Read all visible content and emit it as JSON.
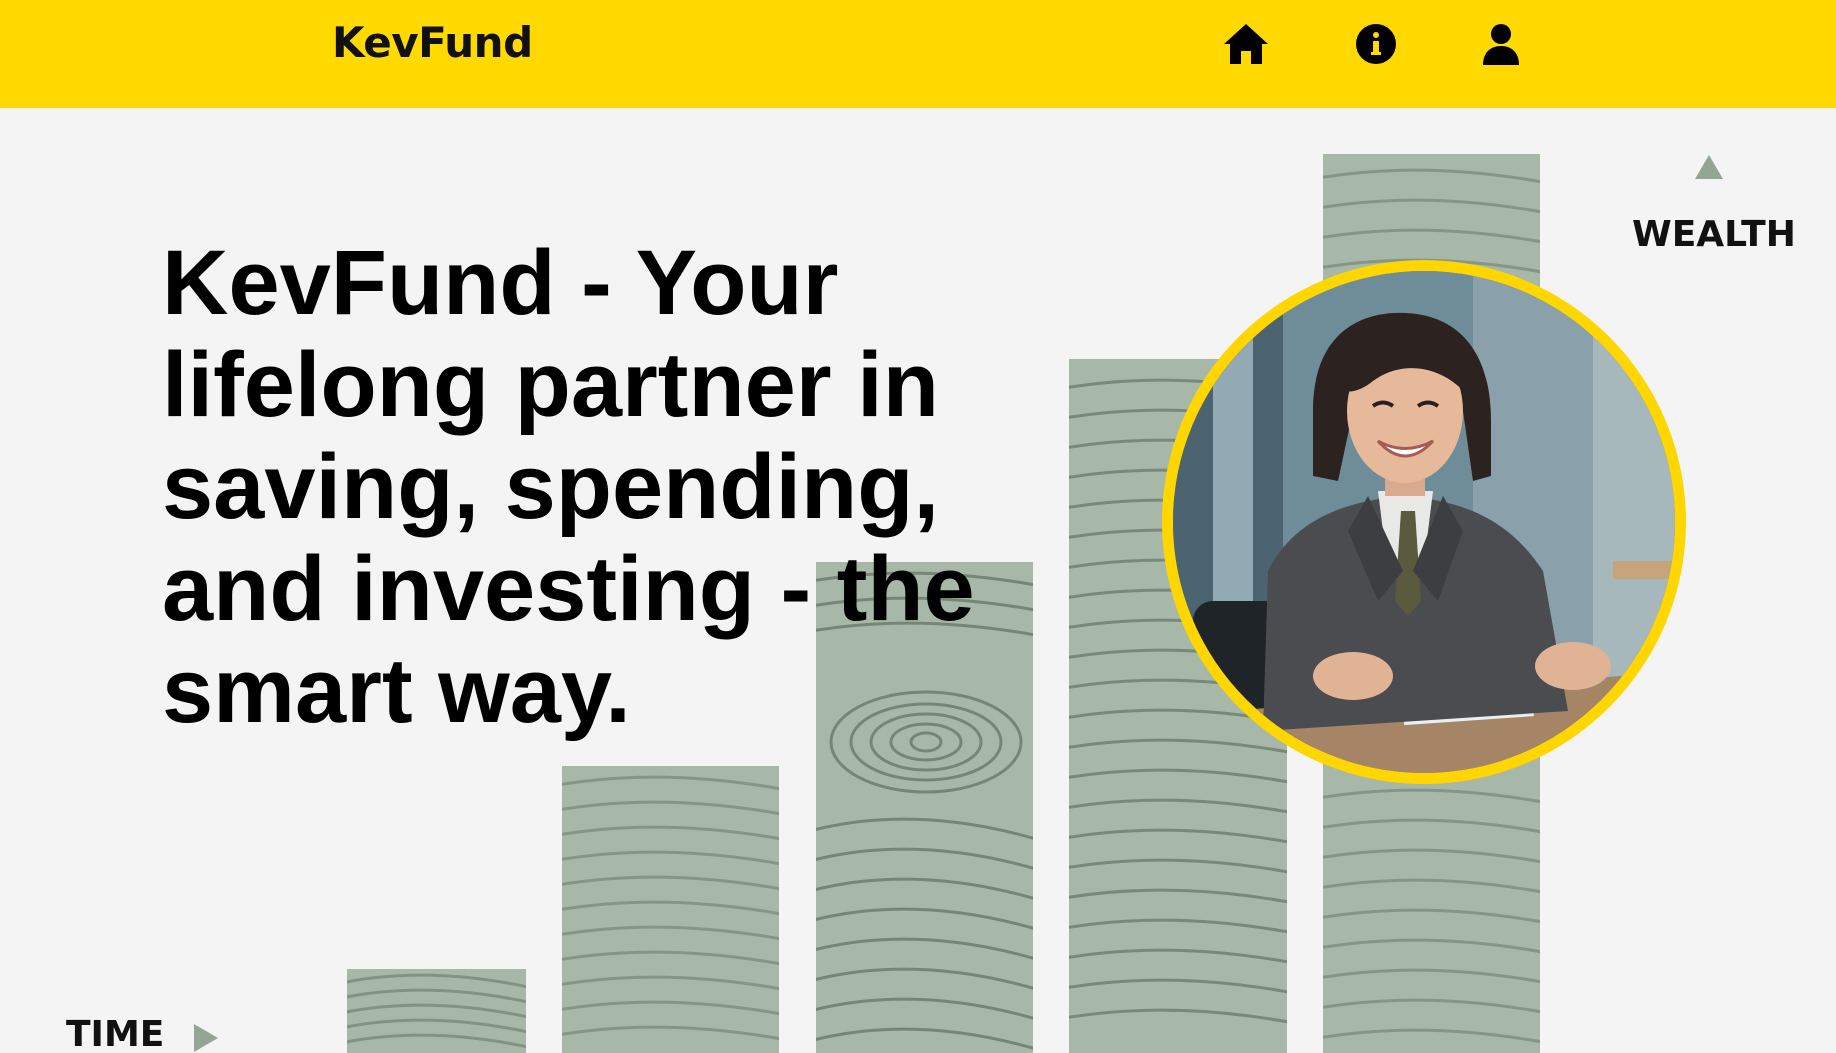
{
  "header": {
    "brand": "KevFund",
    "nav": [
      {
        "icon": "home-icon"
      },
      {
        "icon": "info-icon"
      },
      {
        "icon": "user-icon"
      }
    ],
    "background": "#ffd900"
  },
  "hero": {
    "title": "KevFund - Your lifelong partner in saving, spending, and investing - the smart way."
  },
  "graphic": {
    "y_axis_label": "WEALTH",
    "x_axis_label": "TIME",
    "arrow_color": "#93a593",
    "bar_color": "#a8b8a8",
    "portrait_ring_color": "#ffd600"
  }
}
